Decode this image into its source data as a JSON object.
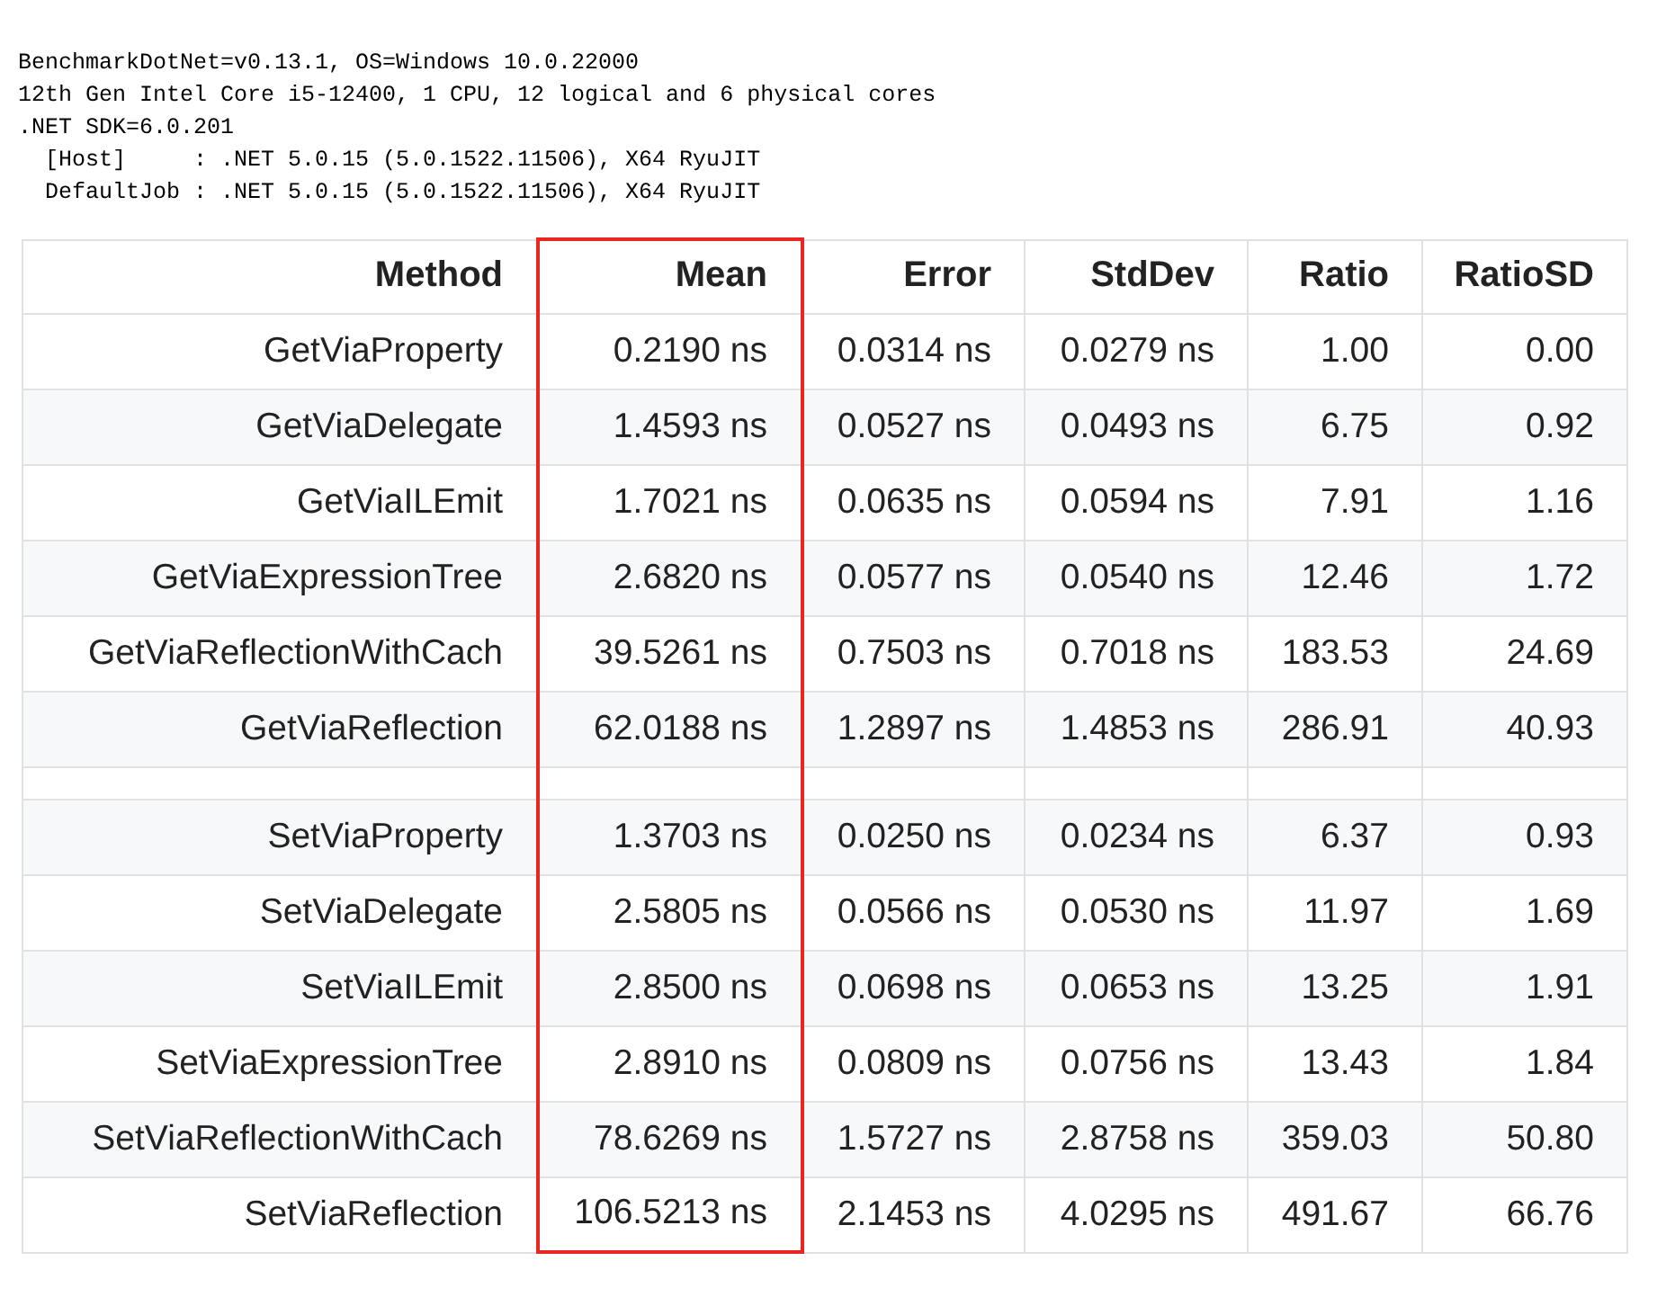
{
  "environment_lines": [
    "BenchmarkDotNet=v0.13.1, OS=Windows 10.0.22000",
    "12th Gen Intel Core i5-12400, 1 CPU, 12 logical and 6 physical cores",
    ".NET SDK=6.0.201",
    "  [Host]     : .NET 5.0.15 (5.0.1522.11506), X64 RyuJIT",
    "  DefaultJob : .NET 5.0.15 (5.0.1522.11506), X64 RyuJIT"
  ],
  "table": {
    "columns": [
      {
        "label": "Method",
        "highlighted": false
      },
      {
        "label": "Mean",
        "highlighted": true
      },
      {
        "label": "Error",
        "highlighted": false
      },
      {
        "label": "StdDev",
        "highlighted": false
      },
      {
        "label": "Ratio",
        "highlighted": false
      },
      {
        "label": "RatioSD",
        "highlighted": false
      }
    ],
    "rows": [
      {
        "kind": "data",
        "cells": [
          "GetViaProperty",
          "0.2190 ns",
          "0.0314 ns",
          "0.0279 ns",
          "1.00",
          "0.00"
        ]
      },
      {
        "kind": "data",
        "cells": [
          "GetViaDelegate",
          "1.4593 ns",
          "0.0527 ns",
          "0.0493 ns",
          "6.75",
          "0.92"
        ]
      },
      {
        "kind": "data",
        "cells": [
          "GetViaILEmit",
          "1.7021 ns",
          "0.0635 ns",
          "0.0594 ns",
          "7.91",
          "1.16"
        ]
      },
      {
        "kind": "data",
        "cells": [
          "GetViaExpressionTree",
          "2.6820 ns",
          "0.0577 ns",
          "0.0540 ns",
          "12.46",
          "1.72"
        ]
      },
      {
        "kind": "data",
        "cells": [
          "GetViaReflectionWithCach",
          "39.5261 ns",
          "0.7503 ns",
          "0.7018 ns",
          "183.53",
          "24.69"
        ]
      },
      {
        "kind": "data",
        "cells": [
          "GetViaReflection",
          "62.0188 ns",
          "1.2897 ns",
          "1.4853 ns",
          "286.91",
          "40.93"
        ]
      },
      {
        "kind": "spacer",
        "cells": []
      },
      {
        "kind": "data",
        "cells": [
          "SetViaProperty",
          "1.3703 ns",
          "0.0250 ns",
          "0.0234 ns",
          "6.37",
          "0.93"
        ]
      },
      {
        "kind": "data",
        "cells": [
          "SetViaDelegate",
          "2.5805 ns",
          "0.0566 ns",
          "0.0530 ns",
          "11.97",
          "1.69"
        ]
      },
      {
        "kind": "data",
        "cells": [
          "SetViaILEmit",
          "2.8500 ns",
          "0.0698 ns",
          "0.0653 ns",
          "13.25",
          "1.91"
        ]
      },
      {
        "kind": "data",
        "cells": [
          "SetViaExpressionTree",
          "2.8910 ns",
          "0.0809 ns",
          "0.0756 ns",
          "13.43",
          "1.84"
        ]
      },
      {
        "kind": "data",
        "cells": [
          "SetViaReflectionWithCach",
          "78.6269 ns",
          "1.5727 ns",
          "2.8758 ns",
          "359.03",
          "50.80"
        ]
      },
      {
        "kind": "data",
        "cells": [
          "SetViaReflection",
          "106.5213 ns",
          "2.1453 ns",
          "4.0295 ns",
          "491.67",
          "66.76"
        ]
      }
    ]
  }
}
